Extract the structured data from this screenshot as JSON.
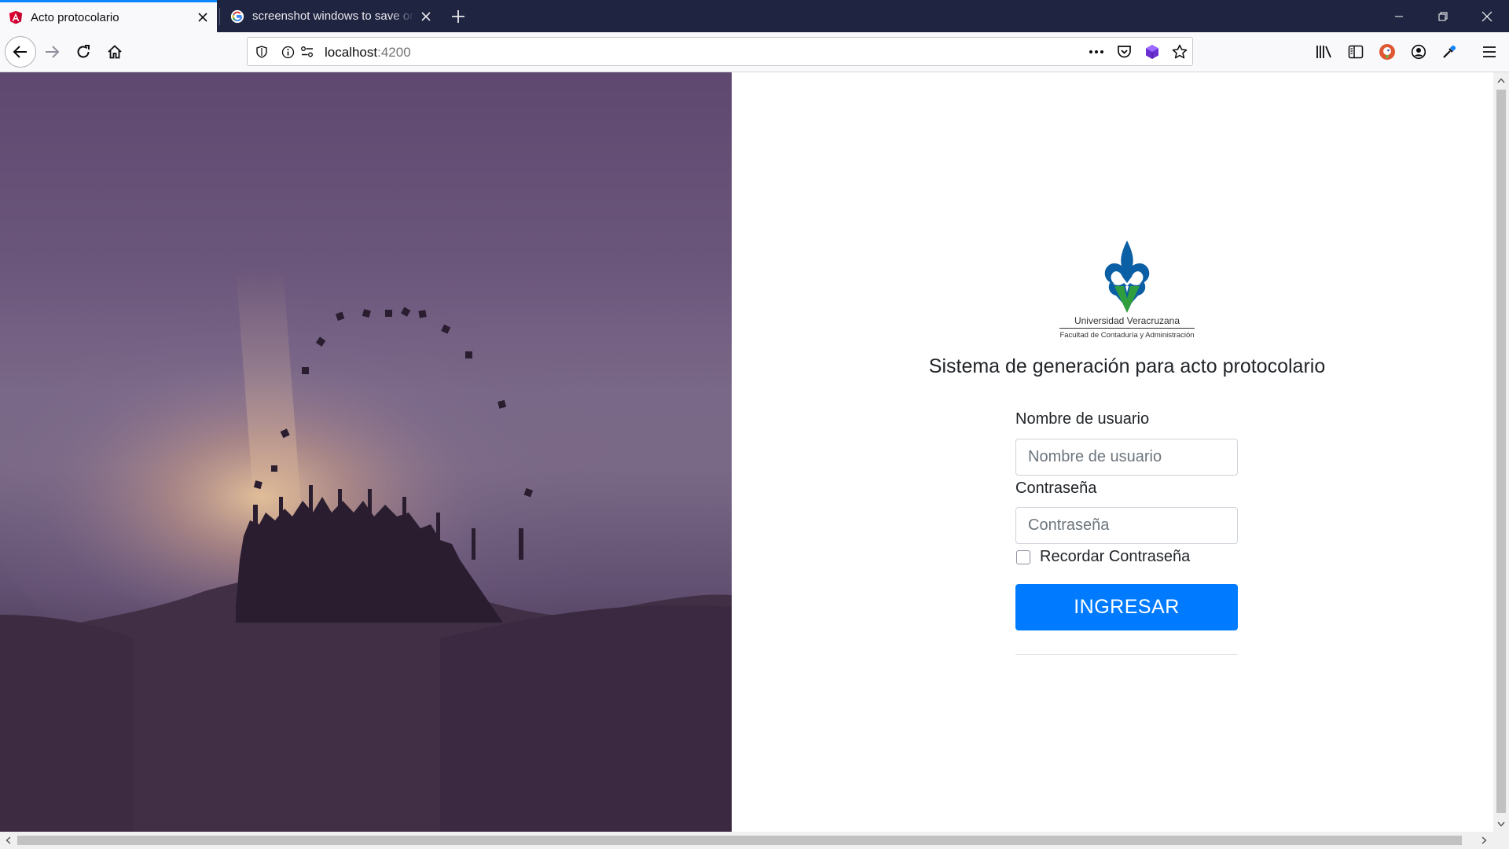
{
  "browser": {
    "tabs": [
      {
        "title": "Acto protocolario",
        "favicon": "angular-icon",
        "active": true
      },
      {
        "title": "screenshot windows to save on",
        "favicon": "google-icon",
        "active": false
      }
    ],
    "url": {
      "host": "localhost",
      "port": ":4200"
    },
    "accent_color": "#0a84ff"
  },
  "page": {
    "logo": {
      "institution": "Universidad Veracruzana",
      "faculty": "Facultad de Contaduría y Administración"
    },
    "heading": "Sistema de generación para acto protocolario",
    "form": {
      "username_label": "Nombre de usuario",
      "username_placeholder": "Nombre de usuario",
      "username_value": "",
      "password_label": "Contraseña",
      "password_placeholder": "Contraseña",
      "password_value": "",
      "remember_label": "Recordar Contraseña",
      "remember_checked": false,
      "submit_label": "INGRESAR"
    },
    "colors": {
      "primary_button": "#007bff",
      "logo_blue": "#0b5fa5",
      "logo_green": "#2e9e3e"
    }
  }
}
